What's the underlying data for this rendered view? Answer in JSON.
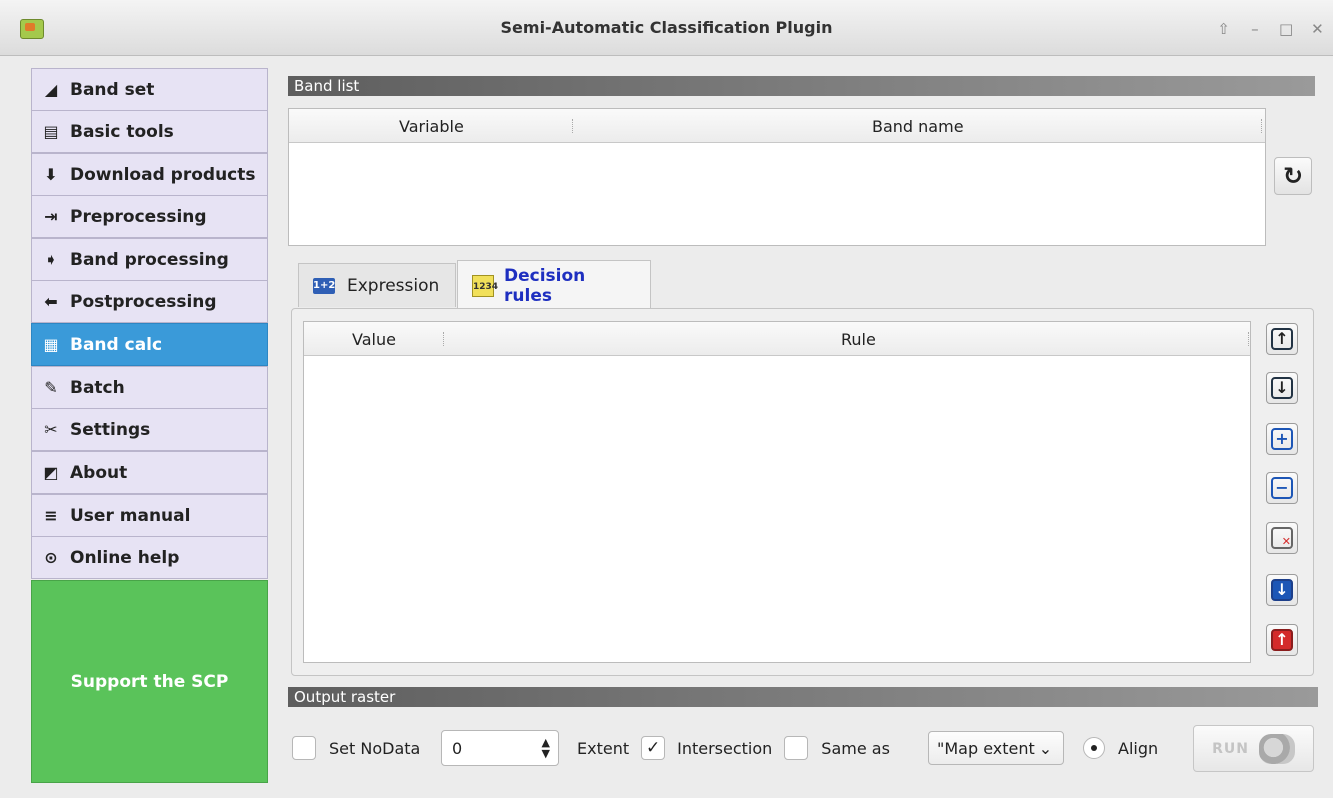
{
  "window": {
    "title": "Semi-Automatic Classification Plugin",
    "controls": [
      "⇧",
      "–",
      "□",
      "✕"
    ]
  },
  "sidebar": {
    "items": [
      {
        "label": "Band set",
        "icon": "band-set-icon",
        "glyph": "◢"
      },
      {
        "label": "Basic tools",
        "icon": "basic-tools-icon",
        "glyph": "▤"
      },
      {
        "label": "Download products",
        "icon": "download-icon",
        "glyph": "⬇"
      },
      {
        "label": "Preprocessing",
        "icon": "preprocessing-icon",
        "glyph": "⇥"
      },
      {
        "label": "Band processing",
        "icon": "band-processing-icon",
        "glyph": "➧"
      },
      {
        "label": "Postprocessing",
        "icon": "postprocessing-icon",
        "glyph": "⬅"
      },
      {
        "label": "Band calc",
        "icon": "calculator-icon",
        "glyph": "▦",
        "active": true
      },
      {
        "label": "Batch",
        "icon": "batch-icon",
        "glyph": "✎"
      },
      {
        "label": "Settings",
        "icon": "settings-icon",
        "glyph": "✂"
      },
      {
        "label": "About",
        "icon": "about-icon",
        "glyph": "◩"
      },
      {
        "label": "User manual",
        "icon": "manual-icon",
        "glyph": "≡"
      },
      {
        "label": "Online help",
        "icon": "help-icon",
        "glyph": "⊙"
      }
    ],
    "support_label": "Support the SCP"
  },
  "band_list": {
    "header": "Band list",
    "columns": [
      "Variable",
      "Band name"
    ],
    "rows": []
  },
  "tabs": [
    {
      "label": "Expression",
      "badge": "1+2"
    },
    {
      "label": "Decision rules",
      "badge": "1234"
    }
  ],
  "rules_table": {
    "columns": [
      "Value",
      "Rule"
    ],
    "rows": []
  },
  "output": {
    "header": "Output raster",
    "set_nodata_label": "Set NoData",
    "nodata_value": "0",
    "extent_label": "Extent",
    "intersection_label": "Intersection",
    "same_as_label": "Same as",
    "same_as_value": "\"Map extent",
    "align_label": "Align",
    "run_label": "RUN"
  },
  "colors": {
    "sidebar_bg": "#e7e3f4",
    "active_item": "#3a9ad9",
    "support_bg": "#5ac35a",
    "active_tab_text": "#1e2fc0"
  }
}
